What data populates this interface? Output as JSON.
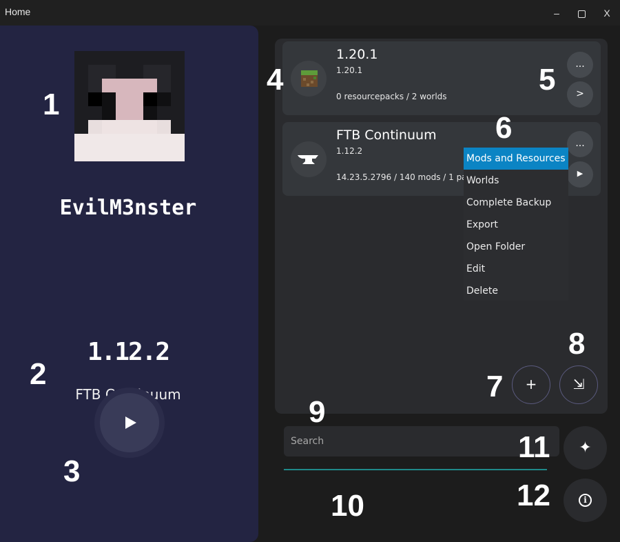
{
  "window": {
    "title": "Home",
    "minimize": "–",
    "close": "X"
  },
  "profile": {
    "username": "EvilM3nster",
    "selected_version": "1.12.2",
    "selected_name": "FTB Continuum"
  },
  "instances": [
    {
      "title": "1.20.1",
      "version": "1.20.1",
      "info": "0 resourcepacks / 2 worlds",
      "icon": "grass-block-icon",
      "more_label": "...",
      "action_label": ">"
    },
    {
      "title": "FTB Continuum",
      "version": "1.12.2",
      "info": "14.23.5.2796 / 140 mods / 1 pac",
      "icon": "anvil-icon",
      "more_label": "...",
      "action_label": "▶"
    }
  ],
  "context_menu": {
    "items": [
      "Mods and Resources",
      "Worlds",
      "Complete Backup",
      "Export",
      "Open Folder",
      "Edit",
      "Delete"
    ],
    "active_index": 0,
    "active_color": "#0b84c4"
  },
  "controls": {
    "add_label": "+",
    "import_label": "⇲",
    "ai_label": "✦",
    "info_label": "i"
  },
  "search": {
    "placeholder": "Search",
    "value": ""
  },
  "annotations": [
    "1",
    "2",
    "3",
    "4",
    "5",
    "6",
    "7",
    "8",
    "9",
    "10",
    "11",
    "12"
  ],
  "colors": {
    "left_panel": "#232442",
    "background": "#1c1c1c",
    "card": "#34373b",
    "accent_line": "#1f8a8a"
  }
}
